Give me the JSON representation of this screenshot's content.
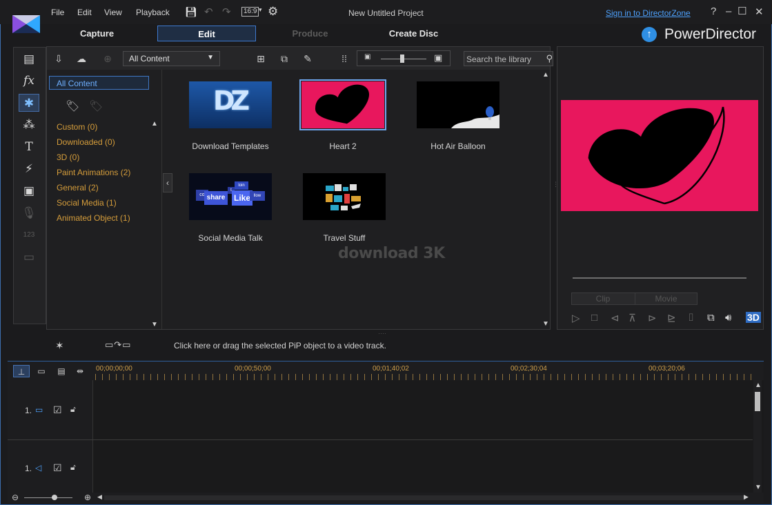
{
  "window": {
    "title": "New Untitled Project",
    "signin_link": "Sign in to DirectorZone",
    "help_label": "?"
  },
  "menu": [
    "File",
    "Edit",
    "View",
    "Playback"
  ],
  "toolbar": {
    "aspect_ratio": "16:9"
  },
  "modes": [
    {
      "label": "Capture",
      "state": "normal"
    },
    {
      "label": "Edit",
      "state": "active"
    },
    {
      "label": "Produce",
      "state": "disabled"
    },
    {
      "label": "Create Disc",
      "state": "normal"
    }
  ],
  "brand": {
    "name": "PowerDirector"
  },
  "library": {
    "filter": "All Content",
    "search_placeholder": "Search the library",
    "selected_category": "All Content",
    "categories": [
      {
        "label": "Custom  (0)"
      },
      {
        "label": "Downloaded  (0)"
      },
      {
        "label": "3D  (0)"
      },
      {
        "label": "Paint Animations  (2)"
      },
      {
        "label": "General  (2)"
      },
      {
        "label": "Social Media  (1)"
      },
      {
        "label": "Animated Object  (1)"
      }
    ],
    "items": [
      {
        "label": "Download Templates",
        "thumb_text": "DZ",
        "selected": false
      },
      {
        "label": "Heart 2",
        "selected": true
      },
      {
        "label": "Hot Air Balloon",
        "selected": false
      },
      {
        "label": "Social Media Talk",
        "thumb_words": [
          "share",
          "Like",
          "co",
          "t",
          "loin",
          "llow"
        ],
        "selected": false
      },
      {
        "label": "Travel Stuff",
        "selected": false
      }
    ],
    "watermark": "download 3K"
  },
  "preview": {
    "clip_label": "Clip",
    "movie_label": "Movie",
    "three_d_label": "3D"
  },
  "pip": {
    "hint": "Click here or drag the selected PiP object to a video track."
  },
  "timeline": {
    "ruler": [
      "00;00;00;00",
      "00;00;50;00",
      "00;01;40;02",
      "00;02;30;04",
      "00;03;20;06"
    ],
    "tracks": [
      {
        "number": "1.",
        "kind": "video"
      },
      {
        "number": "1.",
        "kind": "audio"
      }
    ]
  },
  "colors": {
    "accent": "#3e7ad0",
    "category_text": "#d59d3b",
    "selected_text": "#6fb0ff",
    "heart_pink": "#e8175d",
    "ruler_text": "#d0a04a"
  }
}
